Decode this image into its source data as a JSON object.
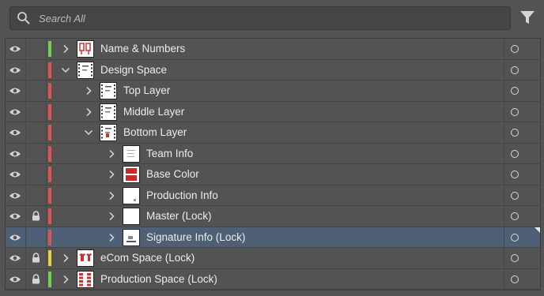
{
  "search": {
    "placeholder": "Search All"
  },
  "colors": {
    "green": "#6fd24f",
    "red": "#e05353",
    "yellow": "#e6d33e",
    "selected_row": "#4f6076"
  },
  "layers": [
    {
      "label": "Name & Numbers",
      "depth": 0,
      "expanded": false,
      "locked": false,
      "color": "green",
      "thumb": "numbers"
    },
    {
      "label": "Design Space",
      "depth": 0,
      "expanded": true,
      "locked": false,
      "color": "red",
      "thumb": "grid"
    },
    {
      "label": "Top Layer",
      "depth": 1,
      "expanded": false,
      "locked": false,
      "color": "red",
      "thumb": "grid"
    },
    {
      "label": "Middle Layer",
      "depth": 1,
      "expanded": false,
      "locked": false,
      "color": "red",
      "thumb": "grid"
    },
    {
      "label": "Bottom Layer",
      "depth": 1,
      "expanded": true,
      "locked": false,
      "color": "red",
      "thumb": "grid-red"
    },
    {
      "label": "Team Info",
      "depth": 2,
      "expanded": false,
      "locked": false,
      "color": "red",
      "thumb": "plain-lines"
    },
    {
      "label": "Base Color",
      "depth": 2,
      "expanded": false,
      "locked": false,
      "color": "red",
      "thumb": "red-block"
    },
    {
      "label": "Production Info",
      "depth": 2,
      "expanded": false,
      "locked": false,
      "color": "red",
      "thumb": "plain-dot"
    },
    {
      "label": "Master (Lock)",
      "depth": 2,
      "expanded": false,
      "locked": true,
      "color": "red",
      "thumb": "blank"
    },
    {
      "label": "Signature Info (Lock)",
      "depth": 2,
      "expanded": false,
      "locked": false,
      "color": "red",
      "thumb": "signature",
      "selected": true
    },
    {
      "label": "eCom Space (Lock)",
      "depth": 0,
      "expanded": false,
      "locked": true,
      "color": "yellow",
      "thumb": "shirts"
    },
    {
      "label": "Production Space (Lock)",
      "depth": 0,
      "expanded": false,
      "locked": true,
      "color": "green",
      "thumb": "strip"
    }
  ]
}
